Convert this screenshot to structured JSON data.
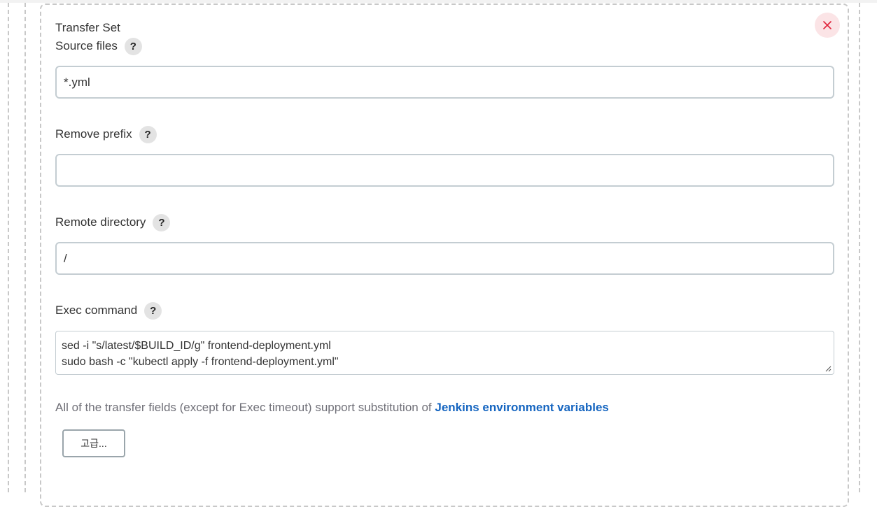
{
  "transfer_set": {
    "title": "Transfer Set",
    "close_icon": "close-icon",
    "accent_color": "#e0243b"
  },
  "fields": {
    "source_files": {
      "label": "Source files",
      "value": "*.yml",
      "help": "?"
    },
    "remove_prefix": {
      "label": "Remove prefix",
      "value": "",
      "help": "?"
    },
    "remote_directory": {
      "label": "Remote directory",
      "value": "/",
      "help": "?"
    },
    "exec_command": {
      "label": "Exec command",
      "help": "?",
      "lines": [
        "sed -i \"s/latest/$BUILD_ID/g\" frontend-deployment.yml",
        "sudo bash -c \"kubectl apply -f frontend-deployment.yml\""
      ]
    }
  },
  "hint": {
    "text": "All of the transfer fields (except for Exec timeout) support substitution of ",
    "link_text": "Jenkins environment variables",
    "link_color": "#1565c0"
  },
  "advanced_button": {
    "label": "고급..."
  }
}
